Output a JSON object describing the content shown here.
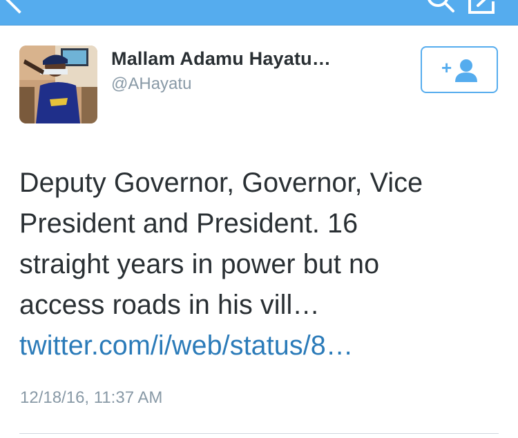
{
  "app": {
    "accent_color": "#55acee",
    "link_color": "#2b7bb9",
    "text_color": "#292f33",
    "secondary_text_color": "#8899a6"
  },
  "top_bar": {
    "left_icon": "back-chevron-icon",
    "right_icons": [
      "search-icon",
      "compose-icon"
    ]
  },
  "tweet": {
    "author": {
      "display_name": "Mallam Adamu Hayatu…",
      "handle": "@AHayatu",
      "avatar": "avatar-photo"
    },
    "follow_button": {
      "icon": "follow-user-plus-icon",
      "label": "+"
    },
    "text_lines": [
      "Deputy Governor, Governor, Vice",
      "President and President. 16",
      "straight years in power but no",
      "access roads in his vill…"
    ],
    "link": "twitter.com/i/web/status/8…",
    "timestamp": "12/18/16, 11:37 AM"
  }
}
